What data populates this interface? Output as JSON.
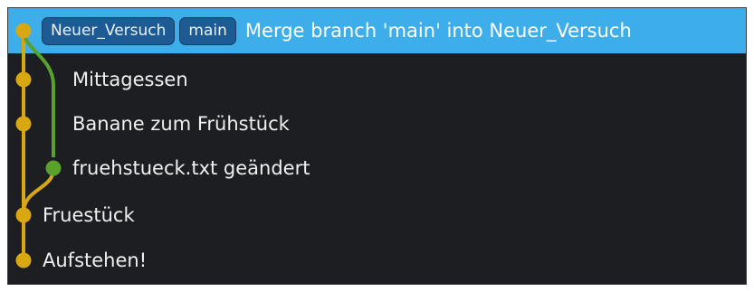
{
  "colors": {
    "background": "#1c1e21",
    "selection": "#3daee9",
    "branch_main": "#d8a711",
    "branch_side": "#5aa02c",
    "ref_badge": "#1e5b94",
    "text": "#eff0f1"
  },
  "commits": [
    {
      "message": "Merge branch 'main' into Neuer_Versuch",
      "refs": [
        "Neuer_Versuch",
        "main"
      ],
      "selected": true,
      "lane": 0
    },
    {
      "message": "Mittagessen",
      "refs": [],
      "selected": false,
      "lane": 0
    },
    {
      "message": "Banane zum Frühstück",
      "refs": [],
      "selected": false,
      "lane": 0
    },
    {
      "message": "fruehstueck.txt geändert",
      "refs": [],
      "selected": false,
      "lane": 1
    },
    {
      "message": "Fruestück",
      "refs": [],
      "selected": false,
      "lane": 0
    },
    {
      "message": "Aufstehen!",
      "refs": [],
      "selected": false,
      "lane": 0
    }
  ]
}
